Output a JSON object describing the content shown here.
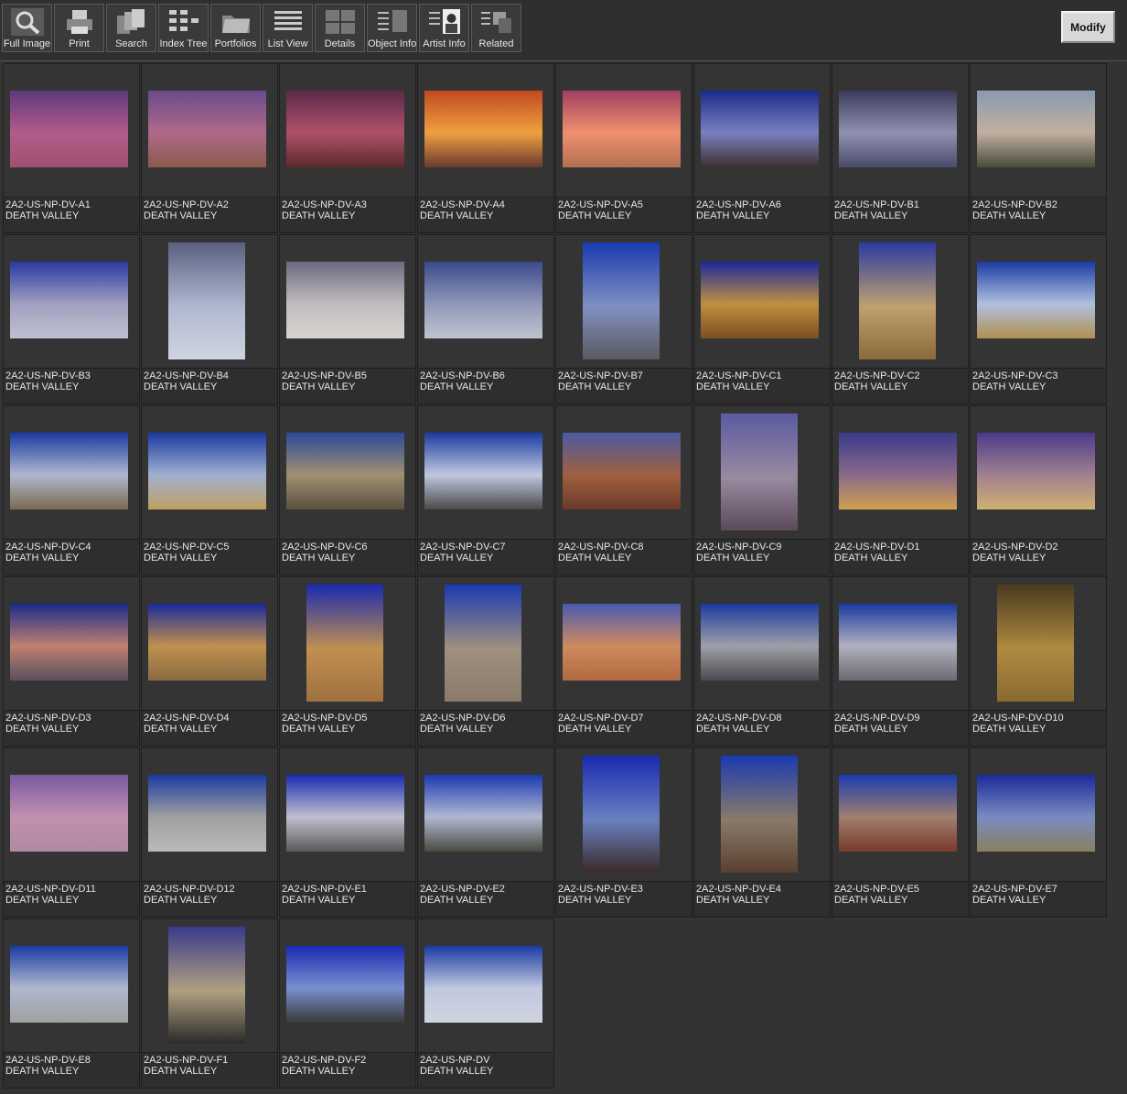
{
  "toolbar": {
    "buttons": [
      {
        "id": "full-image",
        "label": "Full Image",
        "icon": "magnifier-icon"
      },
      {
        "id": "print",
        "label": "Print",
        "icon": "printer-icon"
      },
      {
        "id": "search",
        "label": "Search",
        "icon": "search-stack-icon"
      },
      {
        "id": "index-tree",
        "label": "Index Tree",
        "icon": "index-tree-icon"
      },
      {
        "id": "portfolios",
        "label": "Portfolios",
        "icon": "folder-icon"
      },
      {
        "id": "list-view",
        "label": "List View",
        "icon": "list-icon"
      },
      {
        "id": "details",
        "label": "Details",
        "icon": "details-icon"
      },
      {
        "id": "object-info",
        "label": "Object Info",
        "icon": "object-info-icon"
      },
      {
        "id": "artist-info",
        "label": "Artist  Info",
        "icon": "artist-portrait-icon"
      },
      {
        "id": "related",
        "label": "Related",
        "icon": "related-icon"
      }
    ],
    "modify_label": "Modify"
  },
  "location": "DEATH VALLEY",
  "items": [
    {
      "code": "2A2-US-NP-DV-A1",
      "orient": "h",
      "colors": [
        "#5d3a7a",
        "#b25b8a",
        "#a05070"
      ]
    },
    {
      "code": "2A2-US-NP-DV-A2",
      "orient": "h",
      "colors": [
        "#6a4a8a",
        "#b06a8a",
        "#8a5a4a"
      ]
    },
    {
      "code": "2A2-US-NP-DV-A3",
      "orient": "h",
      "colors": [
        "#5a2a4a",
        "#b0506a",
        "#5a2a2a"
      ]
    },
    {
      "code": "2A2-US-NP-DV-A4",
      "orient": "h",
      "colors": [
        "#c04a20",
        "#f0a040",
        "#6a3a30"
      ]
    },
    {
      "code": "2A2-US-NP-DV-A5",
      "orient": "h",
      "colors": [
        "#a04060",
        "#f09070",
        "#b07050"
      ]
    },
    {
      "code": "2A2-US-NP-DV-A6",
      "orient": "h",
      "colors": [
        "#1a2a8a",
        "#7a80c0",
        "#3a3030"
      ]
    },
    {
      "code": "2A2-US-NP-DV-B1",
      "orient": "h",
      "colors": [
        "#3a3a5a",
        "#9090b0",
        "#4a4a6a"
      ]
    },
    {
      "code": "2A2-US-NP-DV-B2",
      "orient": "h",
      "colors": [
        "#8a9ab0",
        "#c0b0a0",
        "#4a4a3a"
      ]
    },
    {
      "code": "2A2-US-NP-DV-B3",
      "orient": "h",
      "colors": [
        "#2a3aa0",
        "#a0a0c0",
        "#c0c0d0"
      ]
    },
    {
      "code": "2A2-US-NP-DV-B4",
      "orient": "v",
      "colors": [
        "#5a6080",
        "#b0b8d0",
        "#d0d4e0"
      ]
    },
    {
      "code": "2A2-US-NP-DV-B5",
      "orient": "h",
      "colors": [
        "#6a6a80",
        "#c0bcc0",
        "#d8d4d0"
      ]
    },
    {
      "code": "2A2-US-NP-DV-B6",
      "orient": "h",
      "colors": [
        "#3a4a8a",
        "#9098b8",
        "#c0c4d0"
      ]
    },
    {
      "code": "2A2-US-NP-DV-B7",
      "orient": "v",
      "colors": [
        "#1a3ab0",
        "#8090c0",
        "#5a5a60"
      ]
    },
    {
      "code": "2A2-US-NP-DV-C1",
      "orient": "h",
      "colors": [
        "#1a2a9a",
        "#c09040",
        "#7a5020"
      ]
    },
    {
      "code": "2A2-US-NP-DV-C2",
      "orient": "v",
      "colors": [
        "#2a3aa0",
        "#c0a070",
        "#8a6a3a"
      ]
    },
    {
      "code": "2A2-US-NP-DV-C3",
      "orient": "h",
      "colors": [
        "#1a3aa0",
        "#b0c0e0",
        "#b09050"
      ]
    },
    {
      "code": "2A2-US-NP-DV-C4",
      "orient": "h",
      "colors": [
        "#1a3aa0",
        "#b0b8d0",
        "#7a6a50"
      ]
    },
    {
      "code": "2A2-US-NP-DV-C5",
      "orient": "h",
      "colors": [
        "#1a3aa0",
        "#a0b0d0",
        "#c0a060"
      ]
    },
    {
      "code": "2A2-US-NP-DV-C6",
      "orient": "h",
      "colors": [
        "#2a4a9a",
        "#a09070",
        "#5a5040"
      ]
    },
    {
      "code": "2A2-US-NP-DV-C7",
      "orient": "h",
      "colors": [
        "#1a3aa0",
        "#c0c8e0",
        "#4a4a4a"
      ]
    },
    {
      "code": "2A2-US-NP-DV-C8",
      "orient": "h",
      "colors": [
        "#4a5aa0",
        "#a06040",
        "#6a3a2a"
      ]
    },
    {
      "code": "2A2-US-NP-DV-C9",
      "orient": "v",
      "colors": [
        "#5a5aa0",
        "#9a8aa0",
        "#5a4a5a"
      ]
    },
    {
      "code": "2A2-US-NP-DV-D1",
      "orient": "h",
      "colors": [
        "#3a3a8a",
        "#8a6a8a",
        "#d0a050"
      ]
    },
    {
      "code": "2A2-US-NP-DV-D2",
      "orient": "h",
      "colors": [
        "#4a3a8a",
        "#a08090",
        "#d0b070"
      ]
    },
    {
      "code": "2A2-US-NP-DV-D3",
      "orient": "h",
      "colors": [
        "#1a2a8a",
        "#c08070",
        "#5a5060"
      ]
    },
    {
      "code": "2A2-US-NP-DV-D4",
      "orient": "h",
      "colors": [
        "#1a2a9a",
        "#c09050",
        "#8a6a40"
      ]
    },
    {
      "code": "2A2-US-NP-DV-D5",
      "orient": "v",
      "colors": [
        "#1a2ab0",
        "#c09050",
        "#a07040"
      ]
    },
    {
      "code": "2A2-US-NP-DV-D6",
      "orient": "v",
      "colors": [
        "#1a3ab0",
        "#a09080",
        "#8a7a6a"
      ]
    },
    {
      "code": "2A2-US-NP-DV-D7",
      "orient": "h",
      "colors": [
        "#4a5ab0",
        "#d08a60",
        "#b06a40"
      ]
    },
    {
      "code": "2A2-US-NP-DV-D8",
      "orient": "h",
      "colors": [
        "#1a3aa0",
        "#a0a0a8",
        "#4a4a50"
      ]
    },
    {
      "code": "2A2-US-NP-DV-D9",
      "orient": "h",
      "colors": [
        "#1a3aa0",
        "#b0b0c0",
        "#6a6a70"
      ]
    },
    {
      "code": "2A2-US-NP-DV-D10",
      "orient": "v",
      "colors": [
        "#4a3a20",
        "#b08a40",
        "#8a6a30"
      ]
    },
    {
      "code": "2A2-US-NP-DV-D11",
      "orient": "h",
      "colors": [
        "#7a5aa0",
        "#c090b0",
        "#b08aa0"
      ]
    },
    {
      "code": "2A2-US-NP-DV-D12",
      "orient": "h",
      "colors": [
        "#1a3aa0",
        "#a0a0a0",
        "#bababa"
      ]
    },
    {
      "code": "2A2-US-NP-DV-E1",
      "orient": "h",
      "colors": [
        "#1a2ab0",
        "#c0c0d0",
        "#5a5a5a"
      ]
    },
    {
      "code": "2A2-US-NP-DV-E2",
      "orient": "h",
      "colors": [
        "#1a3ab0",
        "#b0b8d0",
        "#4a4a40"
      ]
    },
    {
      "code": "2A2-US-NP-DV-E3",
      "orient": "v",
      "colors": [
        "#1a2ab0",
        "#6a80c0",
        "#3a2a2a"
      ]
    },
    {
      "code": "2A2-US-NP-DV-E4",
      "orient": "v",
      "colors": [
        "#1a3ab0",
        "#8a7a6a",
        "#5a4030"
      ]
    },
    {
      "code": "2A2-US-NP-DV-E5",
      "orient": "h",
      "colors": [
        "#1a3ab0",
        "#a08070",
        "#7a3a2a"
      ]
    },
    {
      "code": "2A2-US-NP-DV-E7",
      "orient": "h",
      "colors": [
        "#1a2a9a",
        "#7a8ac0",
        "#8a8060"
      ]
    },
    {
      "code": "2A2-US-NP-DV-E8",
      "orient": "h",
      "colors": [
        "#1a3aa0",
        "#b0b8d0",
        "#a0a0a0"
      ]
    },
    {
      "code": "2A2-US-NP-DV-F1",
      "orient": "v",
      "colors": [
        "#3a3a8a",
        "#b0a080",
        "#2a2a2a"
      ]
    },
    {
      "code": "2A2-US-NP-DV-F2",
      "orient": "h",
      "colors": [
        "#1a2ab0",
        "#7a90d0",
        "#3a3a3a"
      ]
    },
    {
      "code": "2A2-US-NP-DV",
      "orient": "h",
      "colors": [
        "#1a3aa0",
        "#c0c8e0",
        "#d0d4e0"
      ]
    }
  ]
}
